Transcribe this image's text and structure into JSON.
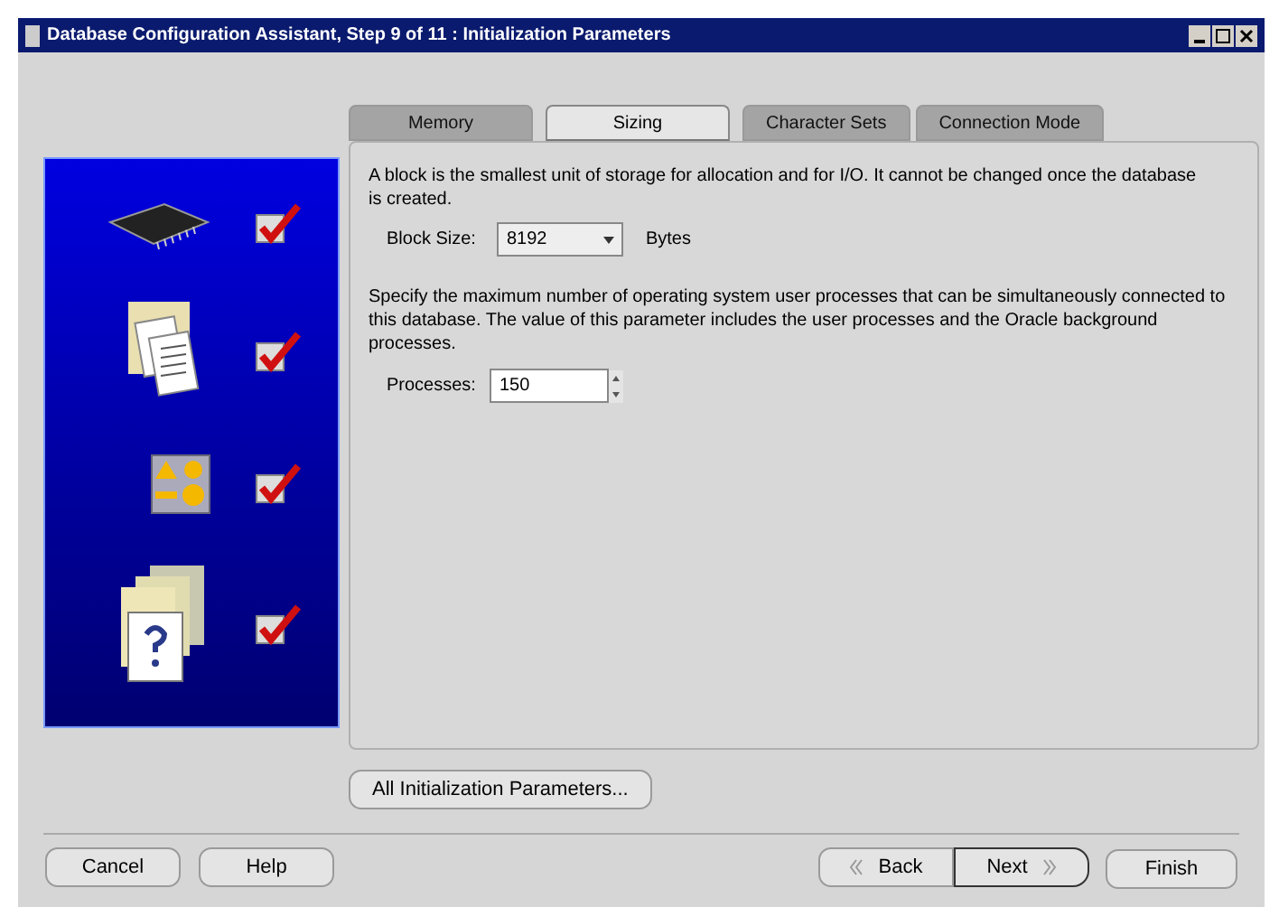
{
  "window": {
    "title": "Database Configuration Assistant, Step 9 of 11 : Initialization Parameters"
  },
  "steps": [
    {
      "kind": "chip",
      "checked": true
    },
    {
      "kind": "documents",
      "checked": true
    },
    {
      "kind": "shapes",
      "checked": true
    },
    {
      "kind": "help-docs",
      "checked": true
    }
  ],
  "tabs": [
    {
      "label": "Memory",
      "selected": false
    },
    {
      "label": "Sizing",
      "selected": true
    },
    {
      "label": "Character Sets",
      "selected": false
    },
    {
      "label": "Connection Mode",
      "selected": false
    }
  ],
  "block": {
    "description": "A block is the smallest unit of storage for allocation and for I/O. It cannot be changed once the database is created.",
    "label": "Block Size:",
    "value": "8192",
    "unit": "Bytes"
  },
  "processes": {
    "description": "Specify the maximum number of operating system user processes that can be simultaneously connected to this database. The value of this parameter includes the user processes and the Oracle background processes.",
    "label": "Processes:",
    "value": "150"
  },
  "all_params_button": "All Initialization Parameters...",
  "left_buttons": [
    {
      "label": "Cancel"
    },
    {
      "label": "Help"
    }
  ],
  "nav_buttons": [
    {
      "label": "Back",
      "kind": "back",
      "default": false
    },
    {
      "label": "Next",
      "kind": "next",
      "default": true
    }
  ],
  "finish_button": "Finish"
}
